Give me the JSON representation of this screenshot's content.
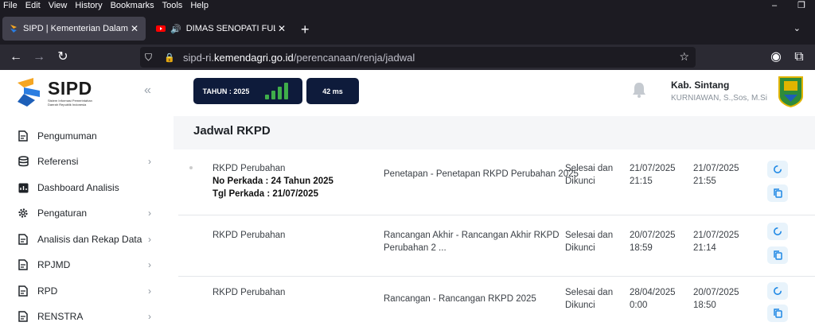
{
  "browser": {
    "menu": [
      "File",
      "Edit",
      "View",
      "History",
      "Bookmarks",
      "Tools",
      "Help"
    ],
    "tabs": [
      {
        "title": "SIPD | Kementerian Dalam Negeri",
        "active": true
      },
      {
        "title": "DIMAS SENOPATI FULL ALBUM",
        "active": false
      }
    ],
    "url_prefix": "sipd-ri.",
    "url_domain": "kemendagri.go.id",
    "url_path": "/perencanaan/renja/jadwal"
  },
  "sidebar": {
    "logo_text": "SIPD",
    "logo_subtitle": "Sistem Informasi Pemerintahan Daerah Republik Indonesia",
    "items": [
      {
        "label": "Pengumuman",
        "icon": "document-icon",
        "has_chevron": false
      },
      {
        "label": "Referensi",
        "icon": "database-icon",
        "has_chevron": true
      },
      {
        "label": "Dashboard Analisis",
        "icon": "dashboard-icon",
        "has_chevron": false
      },
      {
        "label": "Pengaturan",
        "icon": "gear-icon",
        "has_chevron": true
      },
      {
        "label": "Analisis dan Rekap Data",
        "icon": "document-icon",
        "has_chevron": true
      },
      {
        "label": "RPJMD",
        "icon": "document-icon",
        "has_chevron": true
      },
      {
        "label": "RPD",
        "icon": "document-icon",
        "has_chevron": true
      },
      {
        "label": "RENSTRA",
        "icon": "document-icon",
        "has_chevron": true
      }
    ]
  },
  "topbar": {
    "tahun": "TAHUN : 2025",
    "latency": "42 ms",
    "user_name": "Kab. Sintang",
    "user_sub": "KURNIAWAN, S.,Sos, M.Si"
  },
  "page": {
    "title": "Jadwal RKPD"
  },
  "rows": [
    {
      "type": "RKPD Perubahan",
      "no_perkada": "No Perkada : 24 Tahun 2025",
      "tgl_perkada": "Tgl Perkada : 21/07/2025",
      "tahapan": "Penetapan - Penetapan RKPD Perubahan 2025",
      "status_1": "Selesai dan",
      "status_2": "Dikunci",
      "mulai_date": "21/07/2025",
      "mulai_time": "21:15",
      "selesai_date": "21/07/2025",
      "selesai_time": "21:55"
    },
    {
      "type": "RKPD Perubahan",
      "tahapan_1": "Rancangan Akhir - Rancangan Akhir RKPD",
      "tahapan_2": "Perubahan 2 ...",
      "status_1": "Selesai dan",
      "status_2": "Dikunci",
      "mulai_date": "20/07/2025",
      "mulai_time": "18:59",
      "selesai_date": "21/07/2025",
      "selesai_time": "21:14"
    },
    {
      "type": "RKPD Perubahan",
      "tahapan": "Rancangan - Rancangan RKPD 2025",
      "status_1": "Selesai dan",
      "status_2": "Dikunci",
      "mulai_date": "28/04/2025",
      "mulai_time": "0:00",
      "selesai_date": "20/07/2025",
      "selesai_time": "18:50"
    }
  ],
  "colors": {
    "accent_dark": "#0e1b3b",
    "signal_green": "#3fae4a",
    "action_bg": "#e8f3fb",
    "action_icon": "#1e88e5"
  }
}
